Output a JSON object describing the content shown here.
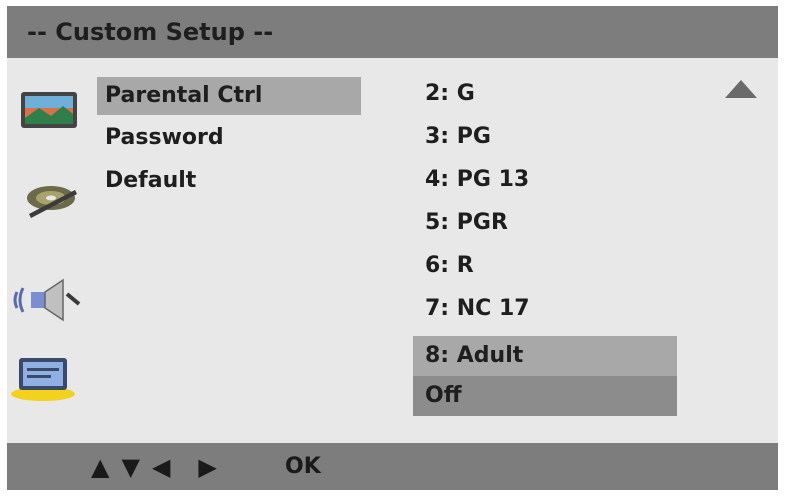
{
  "header": {
    "title": "-- Custom Setup --"
  },
  "icons": {
    "display": "tv-display-icon",
    "disc": "disc-icon",
    "audio": "speaker-icon",
    "custom": "monitor-setup-icon",
    "scroll": "scroll-up-arrow-icon"
  },
  "menu": {
    "items": [
      {
        "label": "Parental Ctrl"
      },
      {
        "label": "Password"
      },
      {
        "label": "Default"
      }
    ]
  },
  "options": {
    "items": [
      {
        "label": "2: G"
      },
      {
        "label": "3: PG"
      },
      {
        "label": "4: PG  13"
      },
      {
        "label": "5: PGR"
      },
      {
        "label": "6: R"
      },
      {
        "label": "7: NC 17"
      },
      {
        "label": "8: Adult"
      },
      {
        "label": "Off"
      }
    ]
  },
  "footer": {
    "arrows": [
      "▲",
      "▼",
      "◀",
      "▶"
    ],
    "ok_label": "OK"
  },
  "colors": {
    "bar": "#7d7d7d",
    "panel": "#e8e8e8",
    "highlight": "#a8a8a8",
    "selected": "#8c8c8c",
    "icon_accent": "#f2d21a"
  }
}
